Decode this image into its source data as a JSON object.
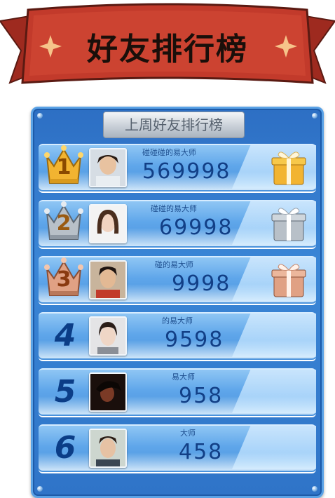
{
  "banner": {
    "title": "好友排行榜"
  },
  "board": {
    "title": "上周好友排行榜"
  },
  "ranks": [
    {
      "rank": "1",
      "name": "碰碰碰的易大师",
      "score": "569998",
      "medal": "gold-crown",
      "gift": "gold-gift"
    },
    {
      "rank": "2",
      "name": "碰碰的易大师",
      "score": "69998",
      "medal": "silver-crown",
      "gift": "silver-gift"
    },
    {
      "rank": "3",
      "name": "碰的易大师",
      "score": "9998",
      "medal": "bronze-crown",
      "gift": "bronze-gift"
    },
    {
      "rank": "4",
      "name": "的易大师",
      "score": "9598"
    },
    {
      "rank": "5",
      "name": "易大师",
      "score": "958"
    },
    {
      "rank": "6",
      "name": "大师",
      "score": "458"
    }
  ],
  "colors": {
    "banner_red": "#c0392b",
    "board_blue": "#2f74c8",
    "gold": "#f2b431",
    "silver": "#b8c0c8",
    "bronze": "#e0a184",
    "score_text": "#123f86"
  }
}
